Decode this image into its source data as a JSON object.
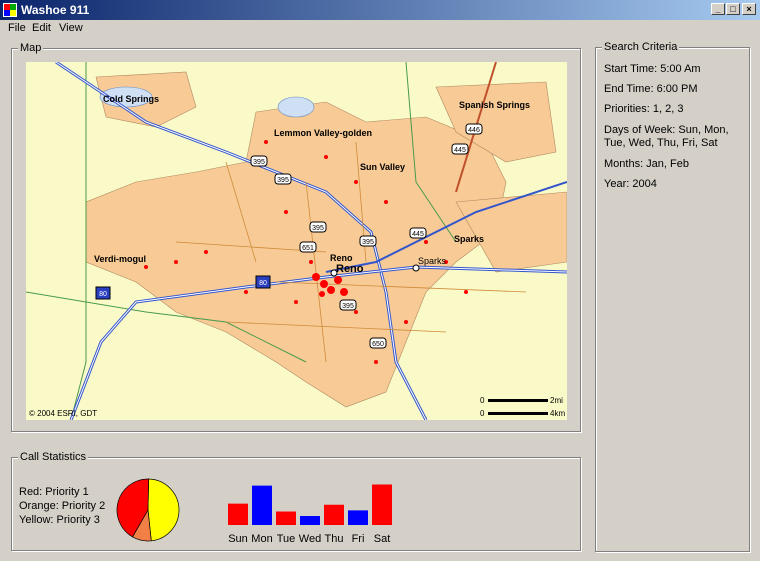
{
  "window": {
    "title": "Washoe 911",
    "minimize": "_",
    "maximize": "□",
    "close": "×"
  },
  "menu": [
    "File",
    "Edit",
    "View"
  ],
  "map": {
    "group_label": "Map",
    "labels": {
      "cold_springs": "Cold Springs",
      "spanish_springs": "Spanish Springs",
      "lemmon_valley": "Lemmon Valley-golden",
      "sun_valley": "Sun Valley",
      "verdi": "Verdi-mogul",
      "sparks_bold": "Sparks",
      "sparks": "Sparks",
      "reno_small": "Reno",
      "reno": "Reno"
    },
    "shields": [
      "395",
      "395",
      "446",
      "445",
      "395",
      "651",
      "395",
      "445",
      "80",
      "80",
      "395",
      "650"
    ],
    "copyright": "© 2004 ESRI, GDT",
    "scale": {
      "zero1": "0",
      "mi": "2mi",
      "zero2": "0",
      "km": "4km"
    },
    "colors": {
      "water": "#cfe0f4",
      "city": "#f7ca96",
      "land": "#fafac8"
    }
  },
  "stats": {
    "group_label": "Call Statistics",
    "legend": [
      "Red: Priority 1",
      "Orange: Priority 2",
      "Yellow: Priority 3"
    ],
    "pie": [
      {
        "priority": "Priority 1",
        "fraction": 0.42,
        "color": "#ff0000"
      },
      {
        "priority": "Priority 2",
        "fraction": 0.1,
        "color": "#f28046"
      },
      {
        "priority": "Priority 3",
        "fraction": 0.48,
        "color": "#ffff00"
      }
    ],
    "days": [
      "Sun",
      "Mon",
      "Tue",
      "Wed",
      "Thu",
      "Fri",
      "Sat"
    ],
    "day_values": [
      19,
      35,
      12,
      8,
      18,
      13,
      36
    ],
    "day_colors": [
      "#ff0000",
      "#0000ff",
      "#ff0000",
      "#0000ff",
      "#ff0000",
      "#0000ff",
      "#ff0000"
    ]
  },
  "criteria": {
    "group_label": "Search Criteria",
    "lines": [
      "Start Time: 5:00 Am",
      "End Time: 6:00 PM",
      "Priorities: 1, 2, 3",
      "Days of Week: Sun, Mon, Tue, Wed, Thu, Fri, Sat",
      "Months: Jan, Feb",
      "Year: 2004"
    ]
  }
}
